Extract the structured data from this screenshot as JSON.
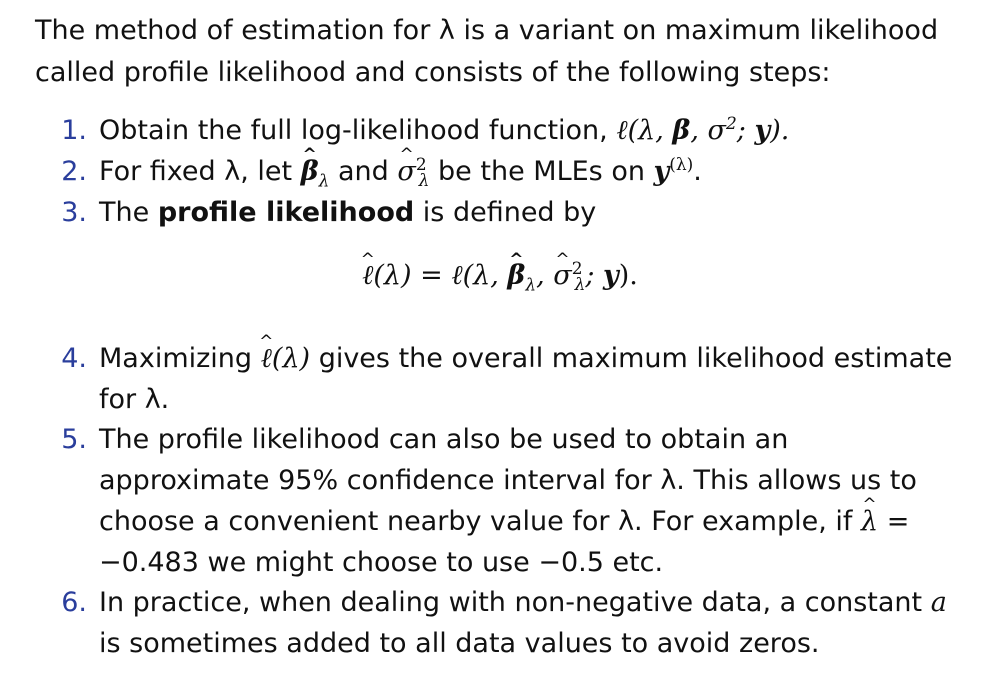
{
  "intro": "The method of estimation for λ is a variant on maximum likelihood called profile likelihood and consists of the following steps:",
  "items": [
    {
      "num": "1.",
      "text": "Obtain the full log-likelihood function,"
    },
    {
      "num": "2.",
      "text_pre": "For fixed λ, let",
      "text_mid": "and",
      "text_post": "be the MLEs on"
    },
    {
      "num": "3.",
      "text_pre": "The",
      "bold": "profile likelihood",
      "text_post": "is defined by"
    },
    {
      "num": "4.",
      "text_pre": "Maximizing",
      "text_post": "gives the overall maximum likelihood estimate for λ."
    },
    {
      "num": "5.",
      "text_pre": "The profile likelihood can also be used to obtain an approximate 95% confidence interval for λ. This allows us to choose a convenient nearby value for λ. For example, if",
      "text_post": "= −0.483 we might choose to use −0.5 etc."
    },
    {
      "num": "6.",
      "text_pre": "In practice, when dealing with non-negative data, a constant",
      "var": "a",
      "text_post": "is sometimes added to all data values to avoid zeros."
    }
  ]
}
